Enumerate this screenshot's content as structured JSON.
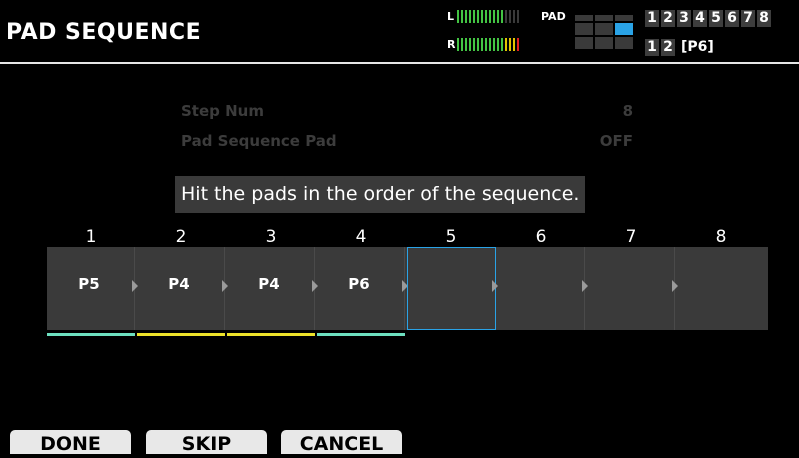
{
  "header": {
    "title": "PAD SEQUENCE",
    "meter_l_label": "L",
    "meter_r_label": "R",
    "pad_label": "PAD",
    "kit_numbers": [
      "1",
      "2",
      "3",
      "4",
      "5",
      "6",
      "7",
      "8"
    ],
    "bank_numbers": [
      "1",
      "2"
    ],
    "pad_tag": "[P6]"
  },
  "params": {
    "step_num_label": "Step Num",
    "step_num_value": "8",
    "pad_seq_pad_label": "Pad Sequence Pad",
    "pad_seq_pad_value": "OFF"
  },
  "message": "Hit the pads in the order of the sequence.",
  "steps": [
    {
      "num": "1",
      "pad": "P5",
      "color": "#6ee0c0"
    },
    {
      "num": "2",
      "pad": "P4",
      "color": "#ede32a"
    },
    {
      "num": "3",
      "pad": "P4",
      "color": "#ede32a"
    },
    {
      "num": "4",
      "pad": "P6",
      "color": "#6ee0c0"
    },
    {
      "num": "5",
      "pad": "",
      "color": ""
    },
    {
      "num": "6",
      "pad": "",
      "color": ""
    },
    {
      "num": "7",
      "pad": "",
      "color": ""
    },
    {
      "num": "8",
      "pad": "",
      "color": ""
    }
  ],
  "selected_step": 5,
  "footer": {
    "done": "DONE",
    "skip": "SKIP",
    "cancel": "CANCEL"
  },
  "colors": {
    "accent": "#2aa3e6",
    "meter_green": "#43c443",
    "meter_yellow": "#e0c400",
    "meter_red": "#e02020"
  }
}
